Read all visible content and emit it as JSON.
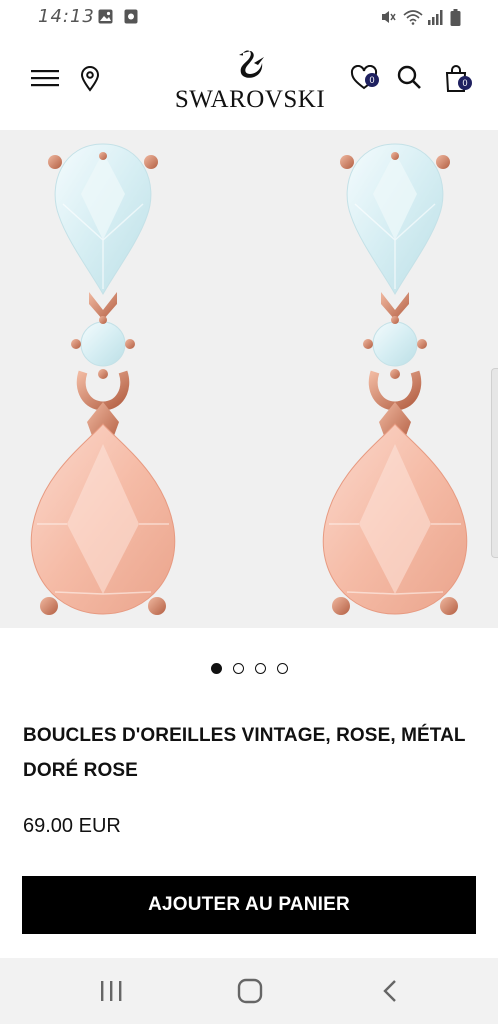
{
  "status_bar": {
    "time": "14:13",
    "icons": [
      "image-icon",
      "notification-icon",
      "mute-icon",
      "wifi-icon",
      "signal-icon",
      "battery-icon"
    ]
  },
  "header": {
    "menu_icon": "hamburger-menu-icon",
    "store_locator_icon": "location-pin-icon",
    "brand": "SWAROVSKI",
    "wishlist_count": "0",
    "search_icon": "search-icon",
    "cart_count": "0"
  },
  "gallery": {
    "image": "product-image-earrings",
    "pages": 4,
    "active_index": 0
  },
  "product": {
    "title": "BOUCLES D'OREILLES VINTAGE, ROSE, MÉTAL DORÉ ROSE",
    "price": "69.00 EUR",
    "add_to_cart_label": "AJOUTER AU PANIER"
  },
  "colors": {
    "accent": "#000000",
    "badge": "#1f2160",
    "rose_gold": "#c9795c",
    "pink_crystal": "#f7c3b1",
    "clear_crystal": "#dcf0f4"
  },
  "nav_bar": {
    "recents": "recent-apps-icon",
    "home": "home-icon",
    "back": "back-icon"
  }
}
